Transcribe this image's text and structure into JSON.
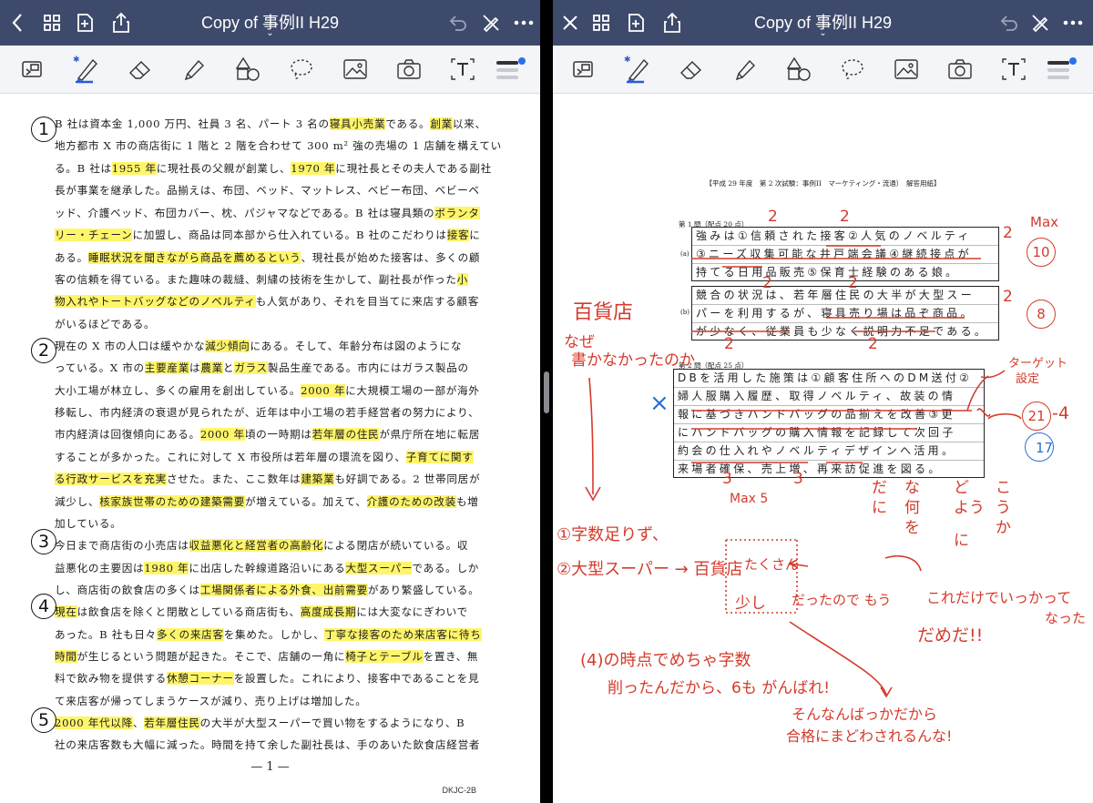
{
  "left": {
    "title": "Copy of 事例II H29",
    "doc_lines": [
      [
        [
          "B 社は資本金 1,000 万円、社員 3 名、パート 3 名の",
          0
        ],
        [
          "寝具小売業",
          1
        ],
        [
          "である。",
          0
        ],
        [
          "創業",
          1
        ],
        [
          "以来、",
          0
        ]
      ],
      [
        [
          "地方都市 X 市の商店街に 1 階と 2 階を合わせて 300 m² 強の売場の 1 店舗を構えてい",
          0
        ]
      ],
      [
        [
          "る。B 社は",
          0
        ],
        [
          "1955 年",
          1
        ],
        [
          "に現社長の父親が創業し、",
          0
        ],
        [
          "1970 年",
          1
        ],
        [
          "に現社長とその夫人である副社",
          0
        ]
      ],
      [
        [
          "長が事業を継承した。品揃えは、布団、ベッド、マットレス、ベビー布団、ベビーベ",
          0
        ]
      ],
      [
        [
          "ッド、介護ベッド、布団カバー、枕、パジャマなどである。B 社は寝具類の",
          0
        ],
        [
          "ボランタ",
          1
        ]
      ],
      [
        [
          "リー・チェーン",
          1
        ],
        [
          "に加盟し、商品は同本部から仕入れている。B 社のこだわりは",
          0
        ],
        [
          "接客",
          1
        ],
        [
          "に",
          0
        ]
      ],
      [
        [
          "ある。",
          0
        ],
        [
          "睡眠状況を聞きながら商品を薦めるという",
          1
        ],
        [
          "、現社長が始めた接客は、多くの顧",
          0
        ]
      ],
      [
        [
          "客の信頼を得ている。また趣味の裁縫、刺繍の技術を生かして、副社長が作った",
          0
        ],
        [
          "小",
          1
        ]
      ],
      [
        [
          "物入れやトートバッグなどのノベルティ",
          1
        ],
        [
          "も人気があり、それを目当てに来店する顧客",
          0
        ]
      ],
      [
        [
          "がいるほどである。",
          0
        ]
      ],
      [
        [
          "現在の X 市の人口は緩やかな",
          0
        ],
        [
          "減少傾向",
          1
        ],
        [
          "にある。そして、年齢分布は図のようにな",
          0
        ]
      ],
      [
        [
          "っている。X 市の",
          0
        ],
        [
          "主要産業",
          1
        ],
        [
          "は",
          0
        ],
        [
          "農業",
          1
        ],
        [
          "と",
          0
        ],
        [
          "ガラス",
          1
        ],
        [
          "製品生産である。市内にはガラス製品の",
          0
        ]
      ],
      [
        [
          "大小工場が林立し、多くの雇用を創出している。",
          0
        ],
        [
          "2000 年",
          1
        ],
        [
          "に大規模工場の一部が海外",
          0
        ]
      ],
      [
        [
          "移転し、市内経済の衰退が見られたが、近年は中小工場の若手経営者の努力により、",
          0
        ]
      ],
      [
        [
          "市内経済は回復傾向にある。",
          0
        ],
        [
          "2000 年",
          1
        ],
        [
          "頃の一時期は",
          0
        ],
        [
          "若年層の住民",
          1
        ],
        [
          "が県庁所在地に転居",
          0
        ]
      ],
      [
        [
          "することが多かった。これに対して X 市役所は若年層の環流を図り、",
          0
        ],
        [
          "子育てに関す",
          1
        ]
      ],
      [
        [
          "る行政サービスを充実",
          1
        ],
        [
          "させた。また、ここ数年は",
          0
        ],
        [
          "建築業",
          1
        ],
        [
          "も好調である。2 世帯同居が",
          0
        ]
      ],
      [
        [
          "減少し、",
          0
        ],
        [
          "核家族世帯のための建築需要",
          1
        ],
        [
          "が増えている。加えて、",
          0
        ],
        [
          "介護のための改装",
          1
        ],
        [
          "も増",
          0
        ]
      ],
      [
        [
          "加している。",
          0
        ]
      ],
      [
        [
          "今日まで商店街の小売店は",
          0
        ],
        [
          "収益悪化と経営者の高齢化",
          1
        ],
        [
          "による閉店が続いている。収",
          0
        ]
      ],
      [
        [
          "益悪化の主要因は",
          0
        ],
        [
          "1980 年",
          1
        ],
        [
          "に出店した幹線道路沿いにある",
          0
        ],
        [
          "大型スーパー",
          1
        ],
        [
          "である。しか",
          0
        ]
      ],
      [
        [
          "し、商店街の飲食店の多くは",
          0
        ],
        [
          "工場関係者による外食、出前需要",
          1
        ],
        [
          "があり繁盛している。",
          0
        ]
      ],
      [
        [
          "現在",
          1
        ],
        [
          "は飲食店を除くと閉散としている商店街も、",
          0
        ],
        [
          "高度成長期",
          1
        ],
        [
          "には大変なにぎわいで",
          0
        ]
      ],
      [
        [
          "あった。B 社も日々",
          0
        ],
        [
          "多くの来店客",
          1
        ],
        [
          "を集めた。しかし、",
          0
        ],
        [
          "丁寧な接客のため来店客に待ち",
          1
        ]
      ],
      [
        [
          "時間",
          1
        ],
        [
          "が生じるという問題が起きた。そこで、店舗の一角に",
          0
        ],
        [
          "椅子とテーブル",
          1
        ],
        [
          "を置き、無",
          0
        ]
      ],
      [
        [
          "料で飲み物を提供する",
          0
        ],
        [
          "休憩コーナー",
          1
        ],
        [
          "を設置した。これにより、接客中であることを見",
          0
        ]
      ],
      [
        [
          "て来店客が帰ってしまうケースが減り、売り上げは増加した。",
          0
        ]
      ],
      [
        [
          "2000 年代以降",
          1
        ],
        [
          "、",
          0
        ],
        [
          "若年層住民",
          1
        ],
        [
          "の大半が大型スーパーで買い物をするようになり、B",
          0
        ]
      ],
      [
        [
          "社の来店客数も大幅に減った。時間を持て余した副社長は、手のあいた飲食店経営者",
          0
        ]
      ]
    ],
    "markers": [
      "1",
      "2",
      "3",
      "4",
      "5"
    ],
    "page_number": "— 1 —",
    "doc_code": "DKJC-2B"
  },
  "right": {
    "title": "Copy of 事例II H29",
    "sheet_title": "【平成 29 年度　第 2 次試験：事例II　マーケティング・流通）　解答用紙】",
    "q1_header": "第 1 問（配点 20 点）",
    "q1a_label": "(a)",
    "q1a_lines": [
      "強みは①信頼された接客②人気のノベルティ",
      "③ニーズ収集可能な井戸端会議④継続接点が",
      "持てる日用品販売⑤保育士経験のある娘。"
    ],
    "q1b_label": "(b)",
    "q1b_lines": [
      "競合の状況は、若年層住民の大半が大型スー",
      "パーを利用するが、寝具売り場は品ぞ商品。",
      "が少なく、従業員も少なく説明力不足である。"
    ],
    "q2_header": "第 2 問（配点 25 点）",
    "q2_lines": [
      "DBを活用した施策は①顧客住所へのDM送付②",
      "婦人服購入履歴、取得ノベルティ、故装の情",
      "報に基づきハンドバッグの品揃えを改善③更",
      "にハンドバッグの購入情報を記録して次回子",
      "約会の仕入れやノベルティデザインへ活用。",
      "来場者確保、売上増、再来訪促進を図る。"
    ],
    "red_notes": {
      "hyakka": "百貨店",
      "naze": "なぜ",
      "kaka": "書かなかったのか",
      "two_a": "2",
      "two_b": "2",
      "two_c": "2",
      "two_d": "2",
      "two_e": "2",
      "two_f": "2",
      "two_g": "2",
      "two_h": "2",
      "two_i": "2",
      "two_j": "2",
      "max": "Max",
      "ten": "10",
      "eight": "8",
      "target": "ターゲット",
      "settei": "設定",
      "twentyone": "21",
      "minus": "-4",
      "three_a": "3",
      "three_b": "3",
      "max5": "Max 5",
      "da": "だ",
      "na": "な",
      "do": "ど",
      "ko": "こ",
      "nii": "に",
      "ka": "か",
      "wo": "を",
      "you": "よう",
      "nani": "何",
      "ni2": "に",
      "ka2": "か",
      "u": "う",
      "moji": "①字数足りず、",
      "big": "②大型スーパー → 百貨店",
      "hyakka2": "百貨店",
      "takusan": "たくさん",
      "sukoshi": "少し",
      "dattanode": "だったので もう",
      "koredake": "これだけでいっかって",
      "natta": "なった",
      "dameda": "だめだ!!",
      "jikan": "(4)の時点でめちゃ字数",
      "kezutta": "削ったんだから、6も がんばれ!",
      "sonnan": "そんなんばっかだから",
      "gokaku": "合格にまどわされるんな!",
      "xmark": "×"
    },
    "blue_note": "17"
  }
}
